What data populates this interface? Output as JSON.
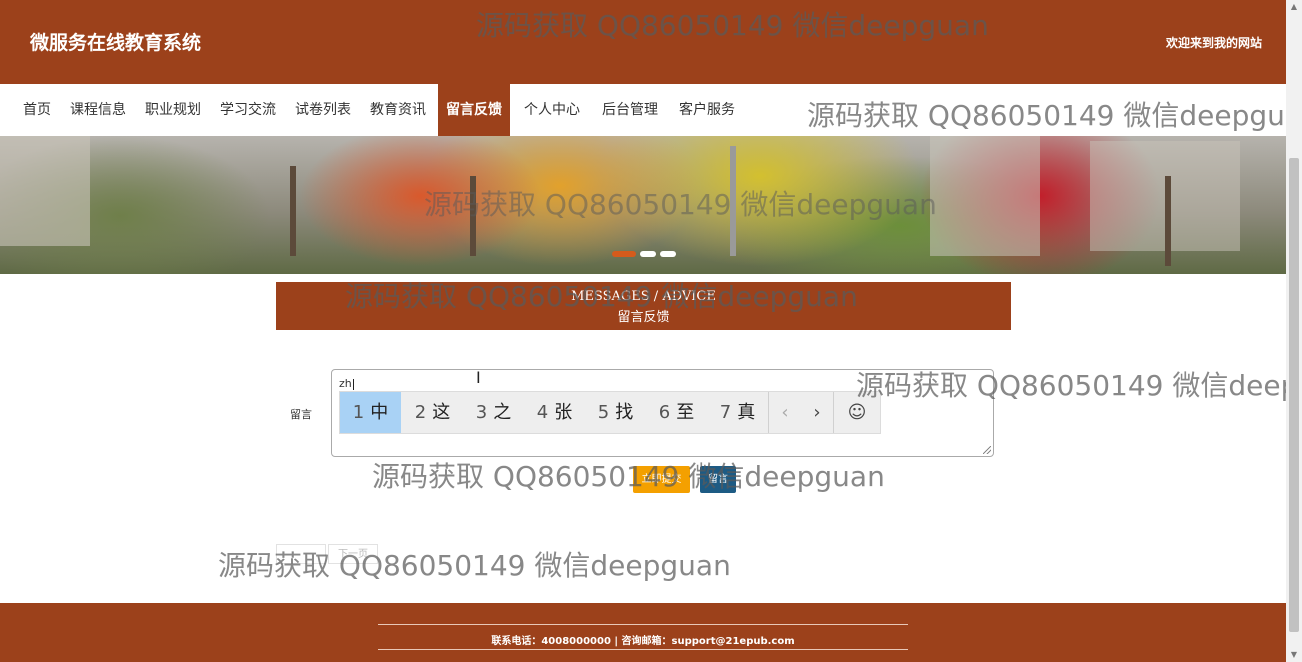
{
  "header": {
    "site_title": "微服务在线教育系统",
    "welcome": "欢迎来到我的网站"
  },
  "nav": {
    "items": [
      {
        "label": "首页"
      },
      {
        "label": "课程信息"
      },
      {
        "label": "职业规划"
      },
      {
        "label": "学习交流"
      },
      {
        "label": "试卷列表"
      },
      {
        "label": "教育资讯"
      },
      {
        "label": "留言反馈",
        "active": true
      },
      {
        "label": "个人中心"
      },
      {
        "label": "后台管理"
      },
      {
        "label": "客户服务"
      }
    ]
  },
  "section": {
    "title_en": "MESSAGES / ADVICE",
    "title_cn": "留言反馈"
  },
  "form": {
    "label": "留言",
    "value": "zh"
  },
  "ime": {
    "candidates": [
      {
        "num": "1",
        "char": "中"
      },
      {
        "num": "2",
        "char": "这"
      },
      {
        "num": "3",
        "char": "之"
      },
      {
        "num": "4",
        "char": "张"
      },
      {
        "num": "5",
        "char": "找"
      },
      {
        "num": "6",
        "char": "至"
      },
      {
        "num": "7",
        "char": "真"
      }
    ],
    "prev": "‹",
    "next": "›",
    "emoji": "☺"
  },
  "buttons": {
    "submit": "立即提交",
    "reset": "留言"
  },
  "pager": {
    "next": "下一页"
  },
  "footer": {
    "text": "联系电话：4008000000 | 咨询邮箱：support@21epub.com"
  },
  "watermark": {
    "text": "源码获取 QQ86050149 微信deepguan"
  },
  "banner": {
    "slides": 3,
    "active_slide": 1
  },
  "colors": {
    "brand": "#9c411b",
    "submit": "#f4a000",
    "reset": "#1d5b84",
    "ime_highlight": "#a9d2f5"
  },
  "icons": {
    "cursor": "text-cursor-icon",
    "prev": "chevron-left-icon",
    "next": "chevron-right-icon",
    "emoji": "smiley-icon"
  }
}
